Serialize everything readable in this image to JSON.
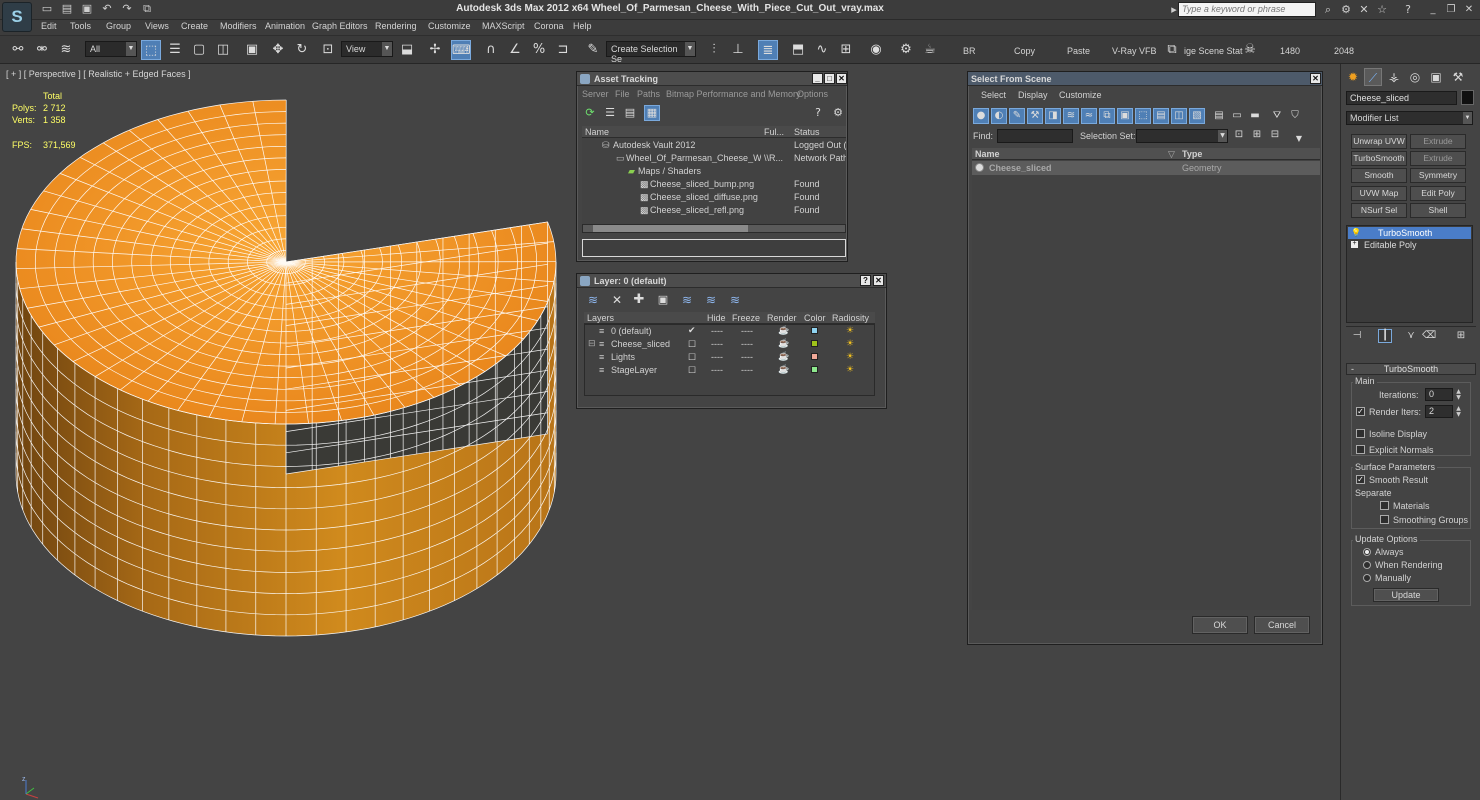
{
  "app": {
    "logo": "S",
    "title": "Autodesk 3ds Max  2012 x64     Wheel_Of_Parmesan_Cheese_With_Piece_Cut_Out_vray.max",
    "search_placeholder": "Type a keyword or phrase"
  },
  "menu": [
    "Edit",
    "Tools",
    "Group",
    "Views",
    "Create",
    "Modifiers",
    "Animation",
    "Graph Editors",
    "Rendering",
    "Customize",
    "MAXScript",
    "Corona",
    "Help"
  ],
  "toolbar": {
    "filter_value": "All",
    "ref_coord_value": "View",
    "selection_set_placeholder": "Create Selection Se",
    "tool_labels": [
      "BR",
      "Copy",
      "Paste",
      "V-Ray VFB",
      "ige Scene Stat",
      "1480",
      "2048"
    ]
  },
  "viewport": {
    "label": "[ + ] [ Perspective ] [ Realistic + Edged Faces ]",
    "stats": {
      "header": "Total",
      "polys_label": "Polys:",
      "polys_value": "2 712",
      "verts_label": "Verts:",
      "verts_value": "1 358",
      "fps_label": "FPS:",
      "fps_value": "371,569"
    },
    "axis": {
      "x": "x",
      "y": "y",
      "z": "z"
    },
    "colors": {
      "cheese_top": "#f39a2c",
      "cheese_side": "#c07a18",
      "cut_face": "#3a3a36",
      "wire": "#ffffff"
    }
  },
  "asset_tracking": {
    "title": "Asset Tracking",
    "menu": [
      "Server",
      "File",
      "Paths",
      "Bitmap Performance and Memory",
      "Options"
    ],
    "columns": [
      "Name",
      "Ful...",
      "Status"
    ],
    "rows": [
      {
        "name": "Autodesk Vault 2012",
        "full": "",
        "status": "Logged Out (..."
      },
      {
        "name": "Wheel_Of_Parmesan_Cheese_W...",
        "full": "\\\\R...",
        "status": "Network Path"
      },
      {
        "name": "Maps / Shaders",
        "full": "",
        "status": ""
      },
      {
        "name": "Cheese_sliced_bump.png",
        "full": "",
        "status": "Found"
      },
      {
        "name": "Cheese_sliced_diffuse.png",
        "full": "",
        "status": "Found"
      },
      {
        "name": "Cheese_sliced_refl.png",
        "full": "",
        "status": "Found"
      }
    ]
  },
  "layer_dialog": {
    "title": "Layer: 0 (default)",
    "columns": [
      "Layers",
      "Hide",
      "Freeze",
      "Render",
      "Color",
      "Radiosity"
    ],
    "rows": [
      {
        "name": "0 (default)",
        "hide": "----",
        "freeze": "----",
        "color": "#8fd3f0",
        "active": true
      },
      {
        "name": "Cheese_sliced",
        "hide": "----",
        "freeze": "----",
        "color": "#9fc21a",
        "active": false
      },
      {
        "name": "Lights",
        "hide": "----",
        "freeze": "----",
        "color": "#f0a898",
        "active": false
      },
      {
        "name": "StageLayer",
        "hide": "----",
        "freeze": "----",
        "color": "#8ee88e",
        "active": false
      }
    ]
  },
  "select_scene": {
    "title": "Select From Scene",
    "menu": [
      "Select",
      "Display",
      "Customize"
    ],
    "find_label": "Find:",
    "selection_set_label": "Selection Set:",
    "columns": [
      "Name",
      "Type"
    ],
    "rows": [
      {
        "name": "Cheese_sliced",
        "type": "Geometry"
      }
    ],
    "ok_label": "OK",
    "cancel_label": "Cancel"
  },
  "command_panel": {
    "object_name": "Cheese_sliced",
    "object_color": "#101010",
    "modifier_list_label": "Modifier List",
    "modifier_buttons": [
      "Unwrap UVW",
      "Extrude",
      "TurboSmooth",
      "Extrude",
      "Smooth",
      "Symmetry",
      "UVW Map",
      "Edit Poly",
      "NSurf Sel",
      "Shell"
    ],
    "stack": [
      "TurboSmooth",
      "Editable Poly"
    ],
    "rollout_title": "TurboSmooth",
    "main_label": "Main",
    "iterations_label": "Iterations:",
    "iterations_value": "0",
    "render_iters_label": "Render Iters:",
    "render_iters_value": "2",
    "isoline_label": "Isoline Display",
    "explicit_normals_label": "Explicit Normals",
    "surface_params_label": "Surface Parameters",
    "smooth_result_label": "Smooth Result",
    "separate_label": "Separate",
    "materials_label": "Materials",
    "smoothing_groups_label": "Smoothing Groups",
    "update_options_label": "Update Options",
    "always_label": "Always",
    "when_rendering_label": "When Rendering",
    "manually_label": "Manually",
    "update_button": "Update"
  }
}
